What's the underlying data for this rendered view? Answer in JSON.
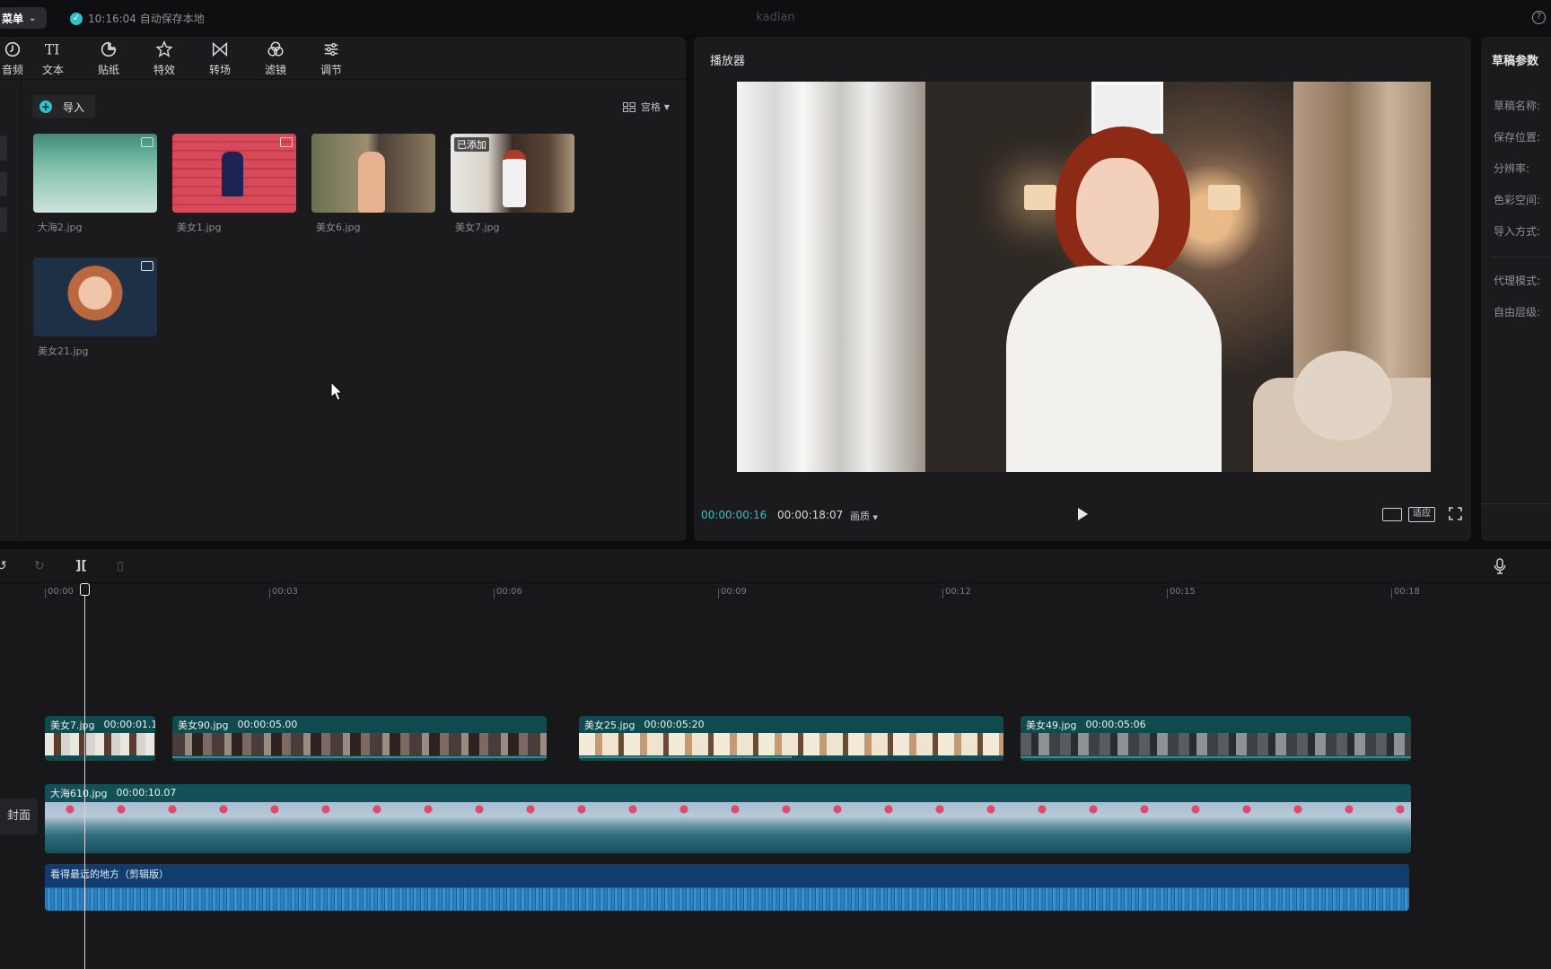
{
  "titlebar": {
    "menu_label": "菜单",
    "autosave_text": "10:16:04 自动保存本地",
    "app_title": "kadian"
  },
  "toolbar": {
    "items": [
      {
        "label": "音频",
        "icon": "audio-icon"
      },
      {
        "label": "文本",
        "icon": "text-icon"
      },
      {
        "label": "贴纸",
        "icon": "sticker-icon"
      },
      {
        "label": "特效",
        "icon": "effects-icon"
      },
      {
        "label": "转场",
        "icon": "transition-icon"
      },
      {
        "label": "滤镜",
        "icon": "filter-icon"
      },
      {
        "label": "调节",
        "icon": "adjust-icon"
      }
    ]
  },
  "media": {
    "import_label": "导入",
    "view_label": "宫格",
    "items": [
      {
        "name": "大海2.jpg",
        "added": false
      },
      {
        "name": "美女1.jpg",
        "added": false
      },
      {
        "name": "美女6.jpg",
        "added": false
      },
      {
        "name": "美女7.jpg",
        "added": true,
        "badge": "已添加"
      },
      {
        "name": "美女21.jpg",
        "added": false
      }
    ]
  },
  "player": {
    "title": "播放器",
    "time_current": "00:00:00:16",
    "time_total": "00:00:18:07",
    "quality_label": "画质",
    "fit_label": "适应"
  },
  "params": {
    "title": "草稿参数",
    "fields": [
      "草稿名称:",
      "保存位置:",
      "分辨率:",
      "色彩空间:",
      "导入方式:",
      "代理模式:",
      "自由层级:"
    ]
  },
  "timeline": {
    "ruler": [
      "00:00",
      "00:03",
      "00:06",
      "00:09",
      "00:12",
      "00:15",
      "00:18"
    ],
    "cover_label": "封面",
    "overlay_clips": [
      {
        "name": "美女7.jpg",
        "duration": "00:00:01.1"
      },
      {
        "name": "美女90.jpg",
        "duration": "00:00:05.00"
      },
      {
        "name": "美女25.jpg",
        "duration": "00:00:05:20"
      },
      {
        "name": "美女49.jpg",
        "duration": "00:00:05:06"
      }
    ],
    "main_clip": {
      "name": "大海610.jpg",
      "duration": "00:00:10.07"
    },
    "audio_clip": {
      "name": "看得最远的地方（剪辑版）"
    }
  },
  "colors": {
    "accent": "#2fc2c9",
    "clip_teal": "#0f4a4e",
    "audio_blue": "#103d6e",
    "background": "#0d0d0f",
    "panel": "#1b1b1e"
  }
}
